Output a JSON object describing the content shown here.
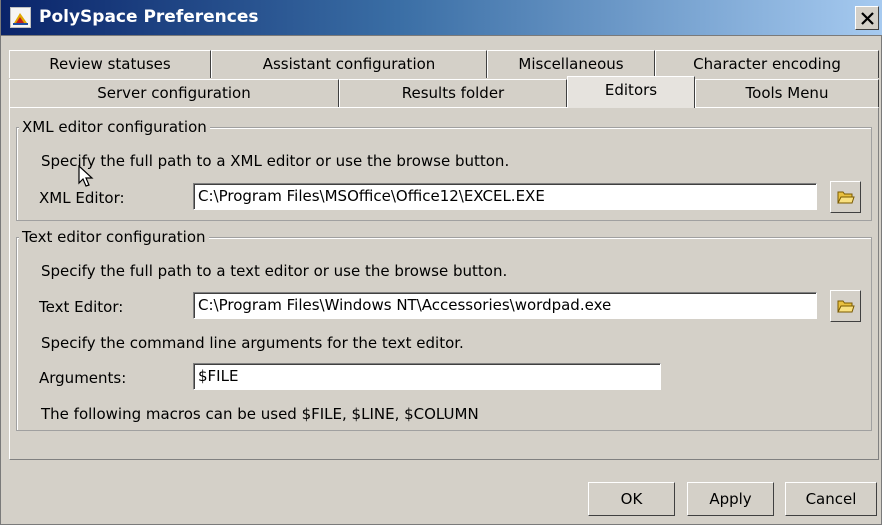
{
  "window": {
    "title": "PolySpace Preferences",
    "icon": "polyspace-app-icon",
    "close_label": "close-icon"
  },
  "tabs": {
    "row1": [
      "Review statuses",
      "Assistant configuration",
      "Miscellaneous",
      "Character encoding"
    ],
    "row2": [
      "Server configuration",
      "Results folder",
      "Editors",
      "Tools Menu"
    ],
    "active": "Editors"
  },
  "xml_group": {
    "legend": "XML editor configuration",
    "hint": "Specify the full path to a XML editor or use the browse button.",
    "field_label": "XML Editor:",
    "value": "C:\\Program Files\\MSOffice\\Office12\\EXCEL.EXE",
    "browse_icon": "folder-open-icon"
  },
  "text_group": {
    "legend": "Text editor configuration",
    "hint": "Specify the full path to a text editor or use the browse button.",
    "field_label": "Text Editor:",
    "value": "C:\\Program Files\\Windows NT\\Accessories\\wordpad.exe",
    "browse_icon": "folder-open-icon",
    "args_hint": "Specify the command line arguments for the text editor.",
    "args_label": "Arguments:",
    "args_value": "$FILE",
    "macros_note": "The following macros can be used $FILE, $LINE, $COLUMN"
  },
  "buttons": {
    "ok": "OK",
    "apply": "Apply",
    "cancel": "Cancel"
  },
  "colors": {
    "title_start": "#0a246a",
    "title_end": "#a6caf0",
    "face": "#d4d0c8"
  }
}
